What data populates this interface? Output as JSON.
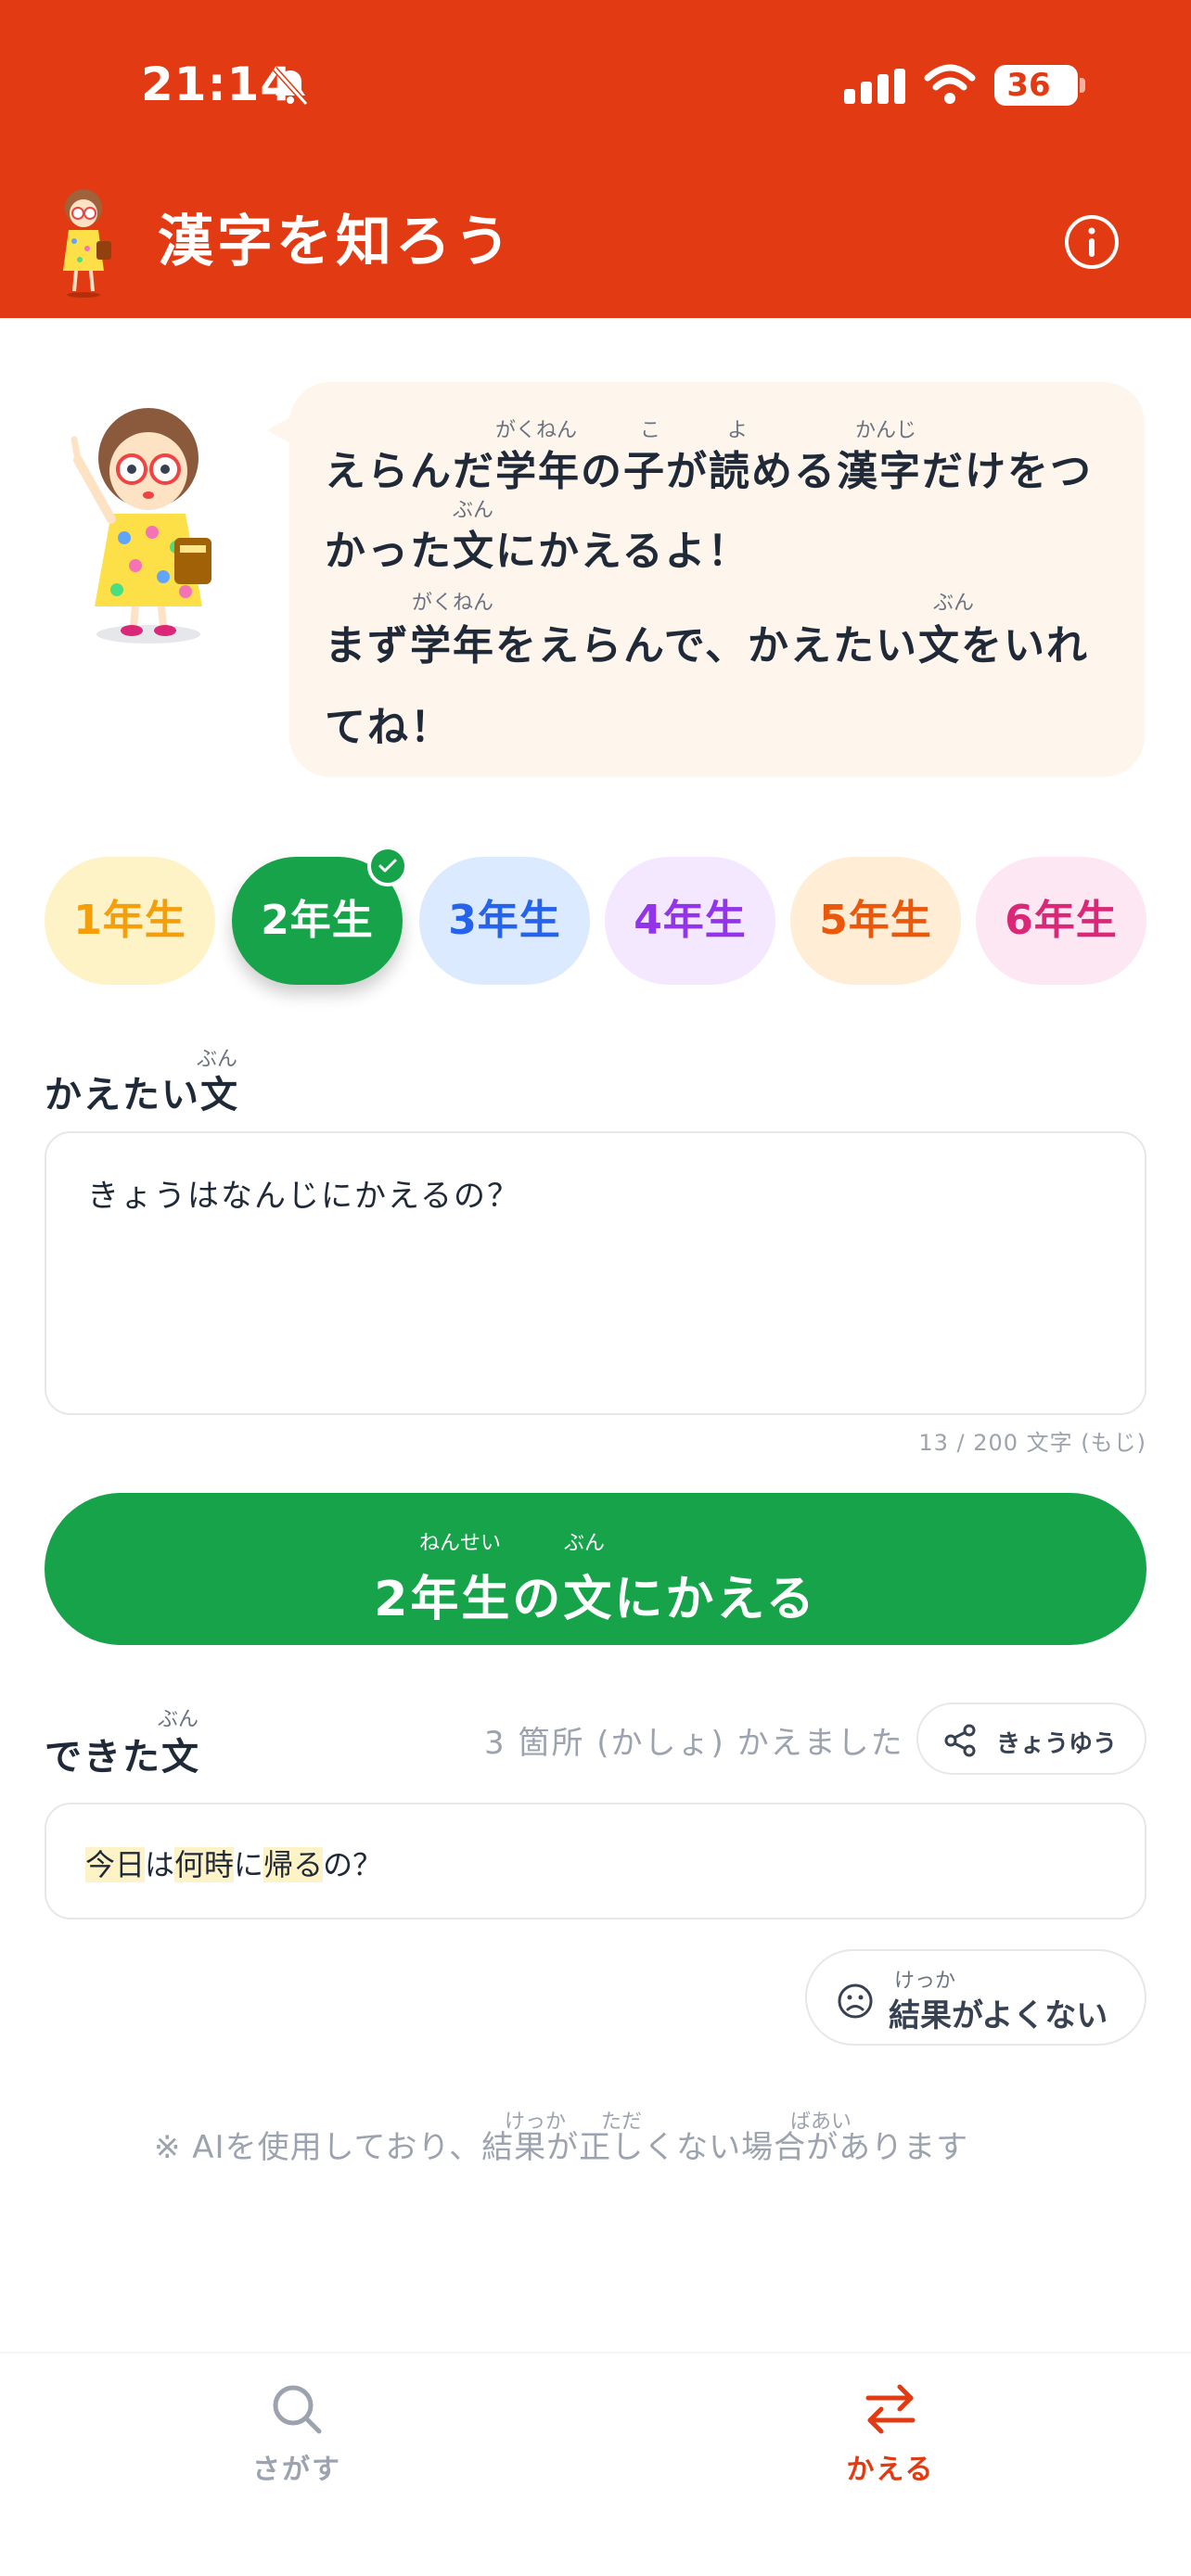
{
  "status_bar": {
    "time": "21:14",
    "battery": "36"
  },
  "header": {
    "title": "漢字を知ろう"
  },
  "intro": {
    "line1": "えらんだ学年の子が読める漢字だけをつ",
    "line2": "かった文にかえるよ！",
    "line3": "まず学年をえらんで、かえたい文をいれ",
    "line4": "てね！",
    "furigana": {
      "l1_gakunen": "がくねん",
      "l1_ko": "こ",
      "l1_yo": "よ",
      "l1_kanji": "かんじ",
      "l2_bun": "ぶん",
      "l3_gakunen": "がくねん",
      "l3_bun": "ぶん"
    }
  },
  "grades": [
    {
      "label": "1年生",
      "color": "#f59e0b",
      "bg": "#fef3c7",
      "selected": false
    },
    {
      "label": "2年生",
      "color": "#ffffff",
      "bg": "#16a34a",
      "selected": true
    },
    {
      "label": "3年生",
      "color": "#2563eb",
      "bg": "#dbeafe",
      "selected": false
    },
    {
      "label": "4年生",
      "color": "#9333ea",
      "bg": "#f3e8ff",
      "selected": false
    },
    {
      "label": "5年生",
      "color": "#ea580c",
      "bg": "#ffedd5",
      "selected": false
    },
    {
      "label": "6年生",
      "color": "#db2777",
      "bg": "#fce7f3",
      "selected": false
    }
  ],
  "input_section": {
    "label": "かえたい文",
    "label_furi": "ぶん",
    "value": "きょうはなんじにかえるの？",
    "counter": "13 / 200 文字 (もじ)"
  },
  "convert_button": {
    "label": "2年生の文にかえる",
    "furi_nensei": "ねんせい",
    "furi_bun": "ぶん"
  },
  "result_section": {
    "label": "できた文",
    "label_furi": "ぶん",
    "changed_count": "3 箇所 (かしょ) かえました",
    "share_label": "きょうゆう",
    "result_parts": [
      {
        "text": "今日",
        "hl": true
      },
      {
        "text": "は",
        "hl": false
      },
      {
        "text": "何時",
        "hl": true
      },
      {
        "text": "に",
        "hl": false
      },
      {
        "text": "帰る",
        "hl": true
      },
      {
        "text": "の？",
        "hl": false
      }
    ],
    "bad_result_label": "結果がよくない",
    "bad_result_furi": "けっか"
  },
  "disclaimer": {
    "text": "※ AIを使用しており、結果が正しくない場合があります",
    "furi_kekka": "けっか",
    "furi_tada": "ただ",
    "furi_baai": "ばあい"
  },
  "nav": {
    "search_label": "さがす",
    "convert_label": "かえる"
  },
  "colors": {
    "header": "#e23a12",
    "accent_green": "#16a34a",
    "nav_active": "#e23a12",
    "nav_inactive": "#9ca3af"
  }
}
